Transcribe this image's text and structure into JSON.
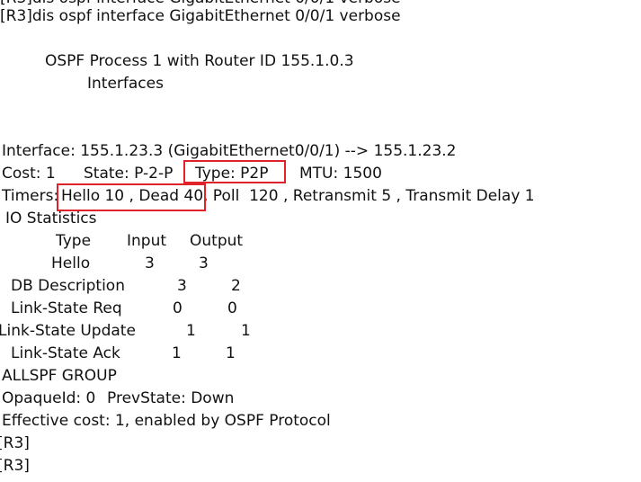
{
  "terminal": {
    "partial_top_line": "[R3]dis ospf interface GigabitEthernet 0/0/1 verbose",
    "command_line": "[R3]dis ospf interface GigabitEthernet 0/0/1 verbose",
    "process_title": "OSPF Process 1 with Router ID 155.1.0.3",
    "interfaces_label": "Interfaces",
    "interface_line": "Interface: 155.1.23.3 (GigabitEthernet0/0/1) --> 155.1.23.2",
    "cost": "Cost: 1",
    "state": "State: P-2-P",
    "type": "Type: P2P",
    "mtu": "MTU: 1500",
    "timers_label": "Timers:",
    "timers_hello_dead": "Hello 10 , Dead 40",
    "timers_rest": ", Poll  120 , Retransmit 5 , Transmit Delay 1",
    "io_statistics": "IO Statistics",
    "io_table": {
      "headers": [
        "Type",
        "Input",
        "Output"
      ],
      "rows": [
        [
          "Hello",
          "3",
          "3"
        ],
        [
          "DB Description",
          "3",
          "2"
        ],
        [
          "Link-State Req",
          "0",
          "0"
        ],
        [
          "Link-State Update",
          "1",
          "1"
        ],
        [
          "Link-State Ack",
          "1",
          "1"
        ]
      ]
    },
    "allspf_group": "ALLSPF GROUP",
    "opaque_id": "OpaqueId: 0",
    "prev_state": "PrevState: Down",
    "effective_cost": "Effective cost: 1, enabled by OSPF Protocol",
    "prompt_1": "[R3]",
    "prompt_2": "[R3]"
  },
  "highlight_color": "#e0222b"
}
